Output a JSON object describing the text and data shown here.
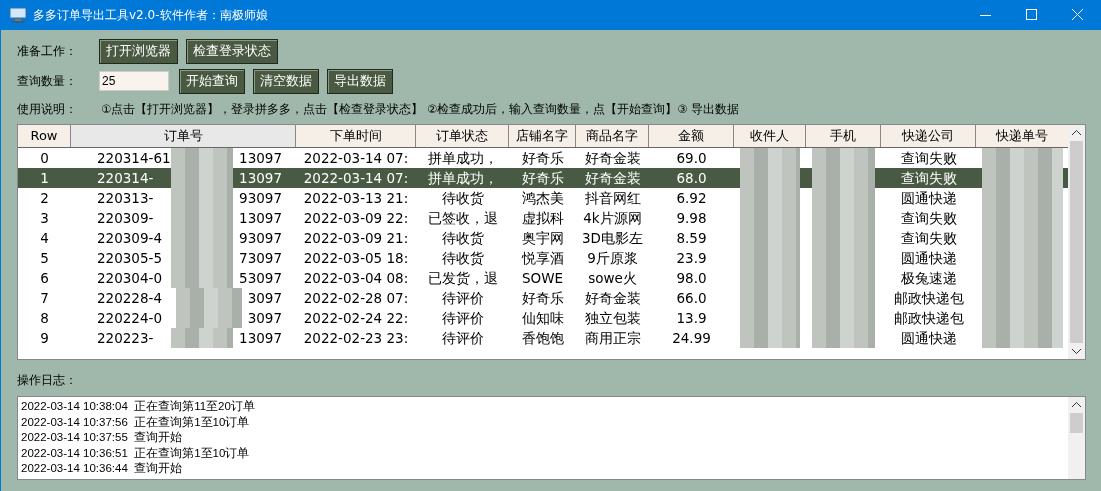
{
  "window": {
    "title": "多多订单导出工具v2.0-软件作者：南极师娘"
  },
  "prep": {
    "label": "准备工作：",
    "buttons": [
      "打开浏览器",
      "检查登录状态"
    ]
  },
  "query": {
    "label": "查询数量：",
    "value": "25",
    "buttons": [
      "开始查询",
      "清空数据",
      "导出数据"
    ]
  },
  "help": {
    "label": "使用说明：",
    "text": "①点击【打开浏览器】，登录拼多多，点击【检查登录状态】 ②检查成功后，输入查询数量，点【开始查询】③ 导出数据"
  },
  "table": {
    "columns": [
      "Row",
      "订单号",
      "下单时间",
      "订单状态",
      "店铺名字",
      "商品名字",
      "金额",
      "收件人",
      "手机",
      "快递公司",
      "快递单号"
    ],
    "rows": [
      {
        "selected": false,
        "order_tail": "13097",
        "cells": [
          "0",
          "220314-61",
          "2022-03-14 07:",
          "拼单成功，",
          "好奇乐",
          "好奇金装",
          "69.0",
          "",
          "",
          "查询失败",
          ""
        ]
      },
      {
        "selected": true,
        "order_tail": "13097",
        "cells": [
          "1",
          "220314-",
          "2022-03-14 07:",
          "拼单成功，",
          "好奇乐",
          "好奇金装",
          "68.0",
          "",
          "",
          "查询失败",
          ""
        ]
      },
      {
        "selected": false,
        "order_tail": "93097",
        "cells": [
          "2",
          "220313-",
          "2022-03-13 21:",
          "待收货",
          "鸿杰美",
          "抖音网红",
          "6.92",
          "",
          "",
          "圆通快递",
          ""
        ]
      },
      {
        "selected": false,
        "order_tail": "13097",
        "cells": [
          "3",
          "220309-",
          "2022-03-09 22:",
          "已签收，退",
          "虚拟科",
          "4k片源网",
          "9.98",
          "",
          "",
          "查询失败",
          ""
        ]
      },
      {
        "selected": false,
        "order_tail": "93097",
        "cells": [
          "4",
          "220309-4",
          "2022-03-09 21:",
          "待收货",
          "奥宇网",
          "3D电影左",
          "8.59",
          "",
          "",
          "查询失败",
          ""
        ]
      },
      {
        "selected": false,
        "order_tail": "73097",
        "cells": [
          "5",
          "220305-5",
          "2022-03-05 18:",
          "待收货",
          "悦享酒",
          "9斤原浆",
          "23.9",
          "",
          "",
          "圆通快递",
          ""
        ]
      },
      {
        "selected": false,
        "order_tail": "53097",
        "cells": [
          "6",
          "220304-0",
          "2022-03-04 08:",
          "已发货，退",
          "SOWE",
          "sowe火",
          "98.0",
          "",
          "",
          "极兔速递",
          ""
        ]
      },
      {
        "selected": false,
        "order_tail": "3097",
        "cells": [
          "7",
          "220228-4",
          "2022-02-28 07:",
          "待评价",
          "好奇乐",
          "好奇金装",
          "66.0",
          "",
          "",
          "邮政快递包",
          ""
        ]
      },
      {
        "selected": false,
        "order_tail": "3097",
        "cells": [
          "8",
          "220224-0",
          "2022-02-24 22:",
          "待评价",
          "仙知味",
          "独立包装",
          "13.9",
          "",
          "",
          "邮政快递包",
          ""
        ]
      },
      {
        "selected": false,
        "order_tail": "13097",
        "cells": [
          "9",
          "220223-",
          "2022-02-23 23:",
          "待评价",
          "香饱饱",
          "商用正宗",
          "24.99",
          "",
          "",
          "圆通快递",
          ""
        ]
      }
    ]
  },
  "log": {
    "label": "操作日志：",
    "lines": [
      "2022-03-14 10:38:04  正在查询第11至20订单",
      "2022-03-14 10:37:56  正在查询第1至10订单",
      "2022-03-14 10:37:55  查询开始",
      "2022-03-14 10:36:51  正在查询第1至10订单",
      "2022-03-14 10:36:44  查询开始"
    ]
  }
}
